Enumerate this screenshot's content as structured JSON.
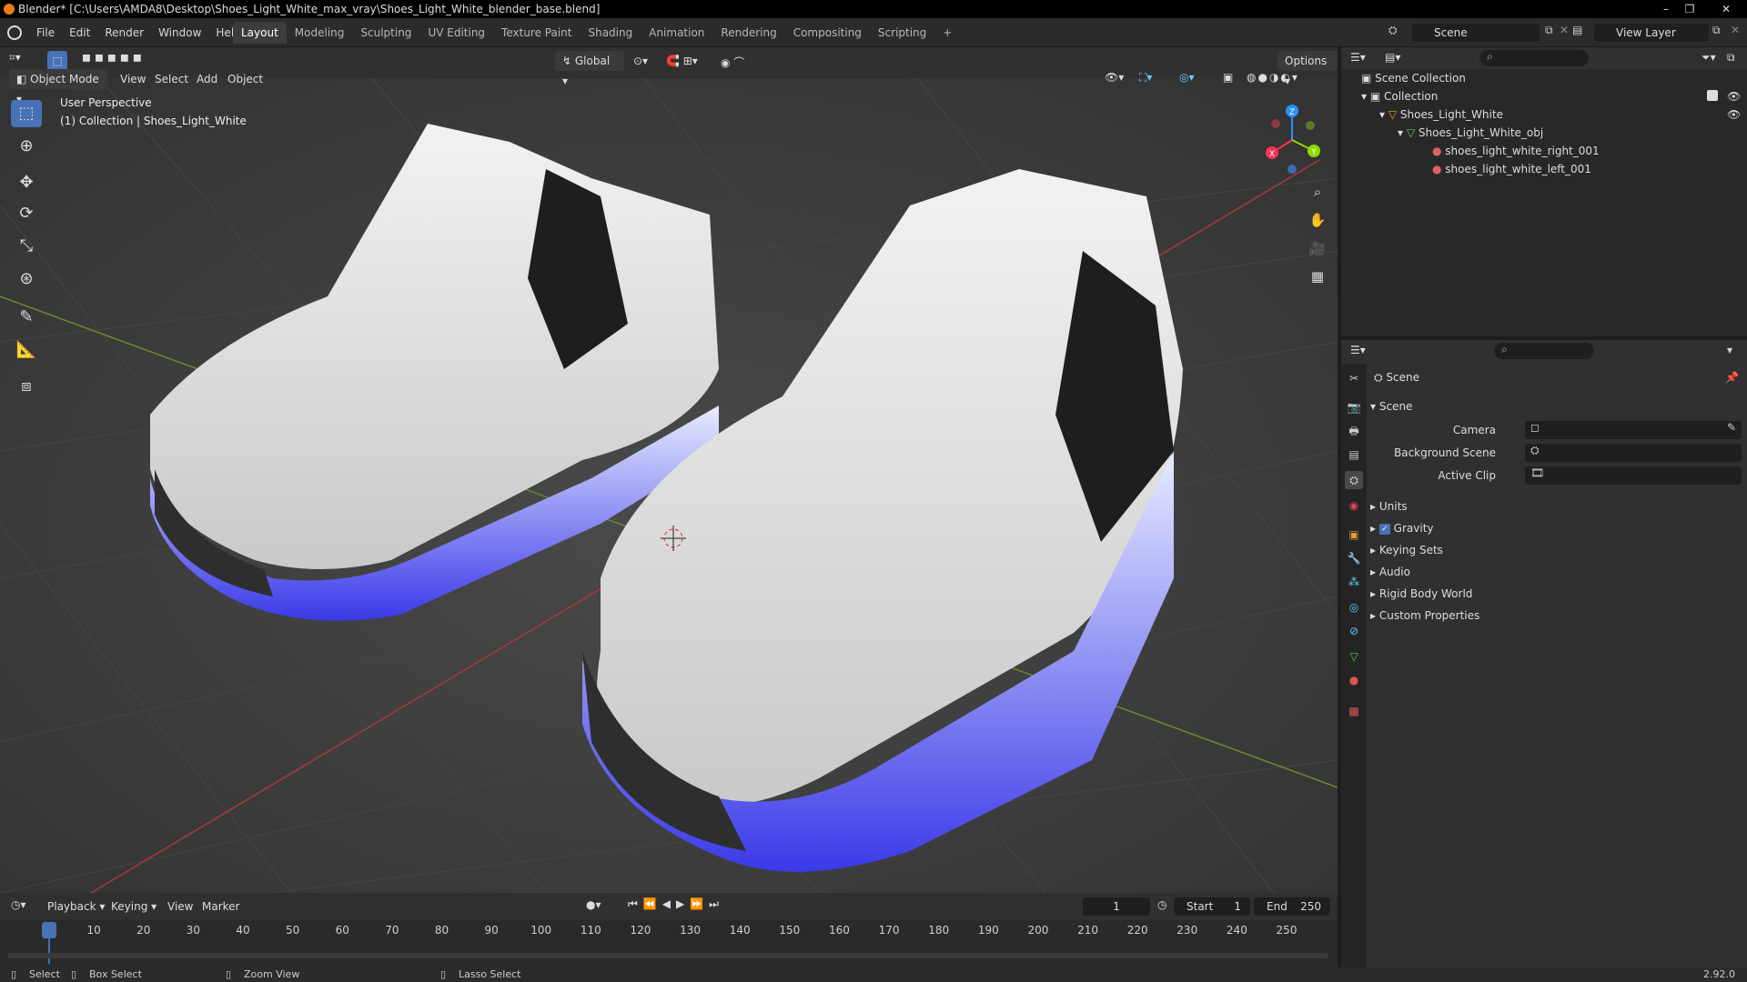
{
  "titlebar": {
    "title": "Blender* [C:\\Users\\AMDA8\\Desktop\\Shoes_Light_White_max_vray\\Shoes_Light_White_blender_base.blend]",
    "min": "–",
    "max": "❐",
    "close": "✕"
  },
  "menubar": {
    "menus": [
      "File",
      "Edit",
      "Render",
      "Window",
      "Help"
    ],
    "workspaces": [
      "Layout",
      "Modeling",
      "Sculpting",
      "UV Editing",
      "Texture Paint",
      "Shading",
      "Animation",
      "Rendering",
      "Compositing",
      "Scripting"
    ],
    "add_tab": "+",
    "scene": "Scene",
    "view_layer": "View Layer"
  },
  "viewport_header": {
    "mode": "Object Mode",
    "menus": [
      "View",
      "Select",
      "Add",
      "Object"
    ],
    "orientation": "Global",
    "options": "Options"
  },
  "viewport": {
    "perspective": "User Perspective",
    "collection_info": "(1) Collection | Shoes_Light_White",
    "gizmo": {
      "x": "X",
      "y": "Y",
      "z": "Z"
    }
  },
  "outliner": {
    "rows": [
      {
        "label": "Scene Collection"
      },
      {
        "label": "Collection"
      },
      {
        "label": "Shoes_Light_White"
      },
      {
        "label": "Shoes_Light_White_obj"
      },
      {
        "label": "shoes_light_white_right_001"
      },
      {
        "label": "shoes_light_white_left_001"
      }
    ]
  },
  "properties": {
    "context": "Scene",
    "panel_title": "Scene",
    "fields": {
      "camera": "Camera",
      "background_scene": "Background Scene",
      "active_clip": "Active Clip"
    },
    "subpanels": [
      "Units",
      "Gravity",
      "Keying Sets",
      "Audio",
      "Rigid Body World",
      "Custom Properties"
    ]
  },
  "timeline": {
    "menus": [
      "Playback",
      "Keying",
      "View",
      "Marker"
    ],
    "current_frame": "1",
    "start_label": "Start",
    "start": "1",
    "end_label": "End",
    "end": "250",
    "ticks": [
      "1",
      "10",
      "20",
      "30",
      "40",
      "50",
      "60",
      "70",
      "80",
      "90",
      "100",
      "110",
      "120",
      "130",
      "140",
      "150",
      "160",
      "170",
      "180",
      "190",
      "200",
      "210",
      "220",
      "230",
      "240",
      "250"
    ]
  },
  "statusbar": {
    "select": "Select",
    "box_select": "Box Select",
    "zoom_view": "Zoom View",
    "lasso_select": "Lasso Select",
    "version": "2.92.0"
  },
  "colors": {
    "accent": "#4772b3",
    "header": "#303030",
    "viewport": "#393939",
    "x_axis": "#ff3352",
    "y_axis": "#8bdc00",
    "z_axis": "#2890ff"
  }
}
